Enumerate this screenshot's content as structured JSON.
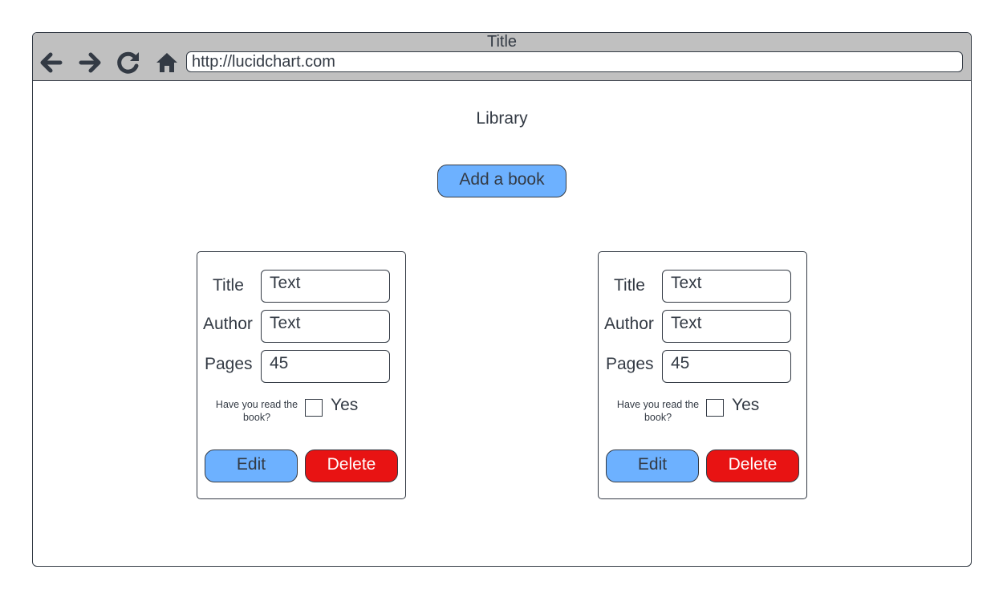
{
  "window": {
    "title": "Title",
    "url": "http://lucidchart.com",
    "nav_icons": [
      "back-arrow-icon",
      "forward-arrow-icon",
      "reload-icon",
      "home-icon"
    ]
  },
  "page": {
    "heading": "Library",
    "add_button": "Add a book"
  },
  "books": [
    {
      "title_label": "Title",
      "title_value": "Text",
      "author_label": "Author",
      "author_value": "Text",
      "pages_label": "Pages",
      "pages_value": "45",
      "read_question": "Have you read the book?",
      "read_checked": false,
      "yes_label": "Yes",
      "edit_label": "Edit",
      "delete_label": "Delete"
    },
    {
      "title_label": "Title",
      "title_value": "Text",
      "author_label": "Author",
      "author_value": "Text",
      "pages_label": "Pages",
      "pages_value": "45",
      "read_question": "Have you read the book?",
      "read_checked": false,
      "yes_label": "Yes",
      "edit_label": "Edit",
      "delete_label": "Delete"
    }
  ],
  "colors": {
    "chrome": "#c0c0c0",
    "stroke": "#333a44",
    "primary_button": "#6db1ff",
    "danger_button": "#e81313"
  }
}
